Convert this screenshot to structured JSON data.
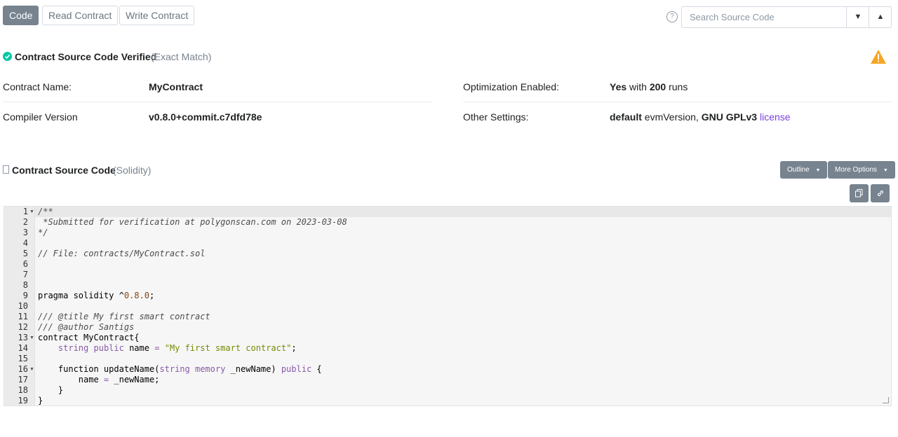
{
  "tabs": [
    {
      "label": "Code",
      "active": true
    },
    {
      "label": "Read Contract",
      "active": false
    },
    {
      "label": "Write Contract",
      "active": false
    }
  ],
  "search": {
    "placeholder": "Search Source Code"
  },
  "verified": {
    "title": "Contract Source Code Verified",
    "subtitle": "(Exact Match)"
  },
  "info": {
    "contract_name_label": "Contract Name:",
    "contract_name_value": "MyContract",
    "compiler_label": "Compiler Version",
    "compiler_value": "v0.8.0+commit.c7dfd78e",
    "optimization_label": "Optimization Enabled:",
    "optimization_yes": "Yes",
    "optimization_with": "with",
    "optimization_runs_count": "200",
    "optimization_runs": "runs",
    "other_label": "Other Settings:",
    "other_default": "default",
    "other_evm": "evmVersion,",
    "other_license_type": "GNU GPLv3",
    "other_license_link": "license"
  },
  "source": {
    "title": "Contract Source Code",
    "subtitle": "(Solidity)",
    "outline_label": "Outline",
    "more_options_label": "More Options"
  },
  "code": {
    "line_numbers": [
      "1",
      "2",
      "3",
      "4",
      "5",
      "6",
      "7",
      "8",
      "9",
      "10",
      "11",
      "12",
      "13",
      "14",
      "15",
      "16",
      "17",
      "18",
      "19"
    ],
    "lines": [
      "/**",
      " *Submitted for verification at polygonscan.com on 2023-03-08",
      "*/",
      "",
      "// File: contracts/MyContract.sol",
      "",
      "",
      "",
      "pragma solidity ^0.8.0;",
      "",
      "/// @title My first smart contract",
      "/// @author Santigs",
      "contract MyContract{",
      "    string public name = \"My first smart contract\";",
      "",
      "    function updateName(string memory _newName) public {",
      "        name = _newName;",
      "    }",
      "}"
    ]
  },
  "colors": {
    "accent": "#77838f",
    "verified": "#00c9a7",
    "warning": "#f5a623",
    "link": "#7b3fe4"
  }
}
